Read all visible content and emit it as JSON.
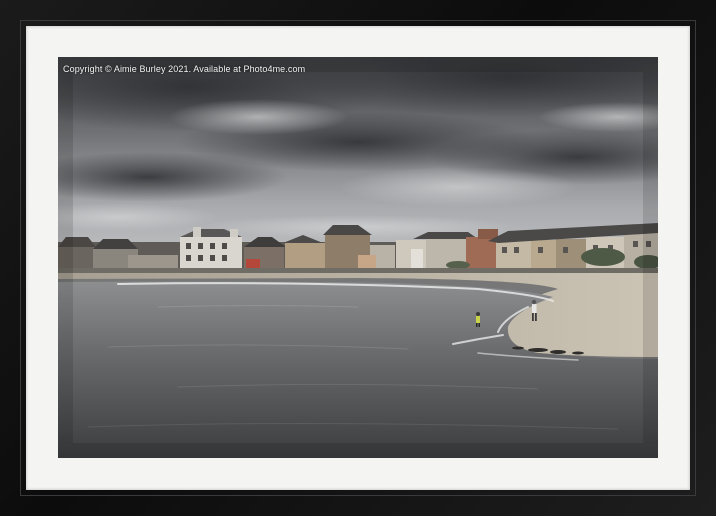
{
  "watermark": "Copyright © Aimie Burley 2021. Available at Photo4me.com",
  "frame_color": "#111111",
  "mount_color": "#f4f4f2",
  "scene": {
    "subject": "coastal-town-beach",
    "palette": {
      "sky": "#8a8c8f",
      "sea": "#5a5b5d",
      "sand": "#bfb7a8"
    }
  }
}
